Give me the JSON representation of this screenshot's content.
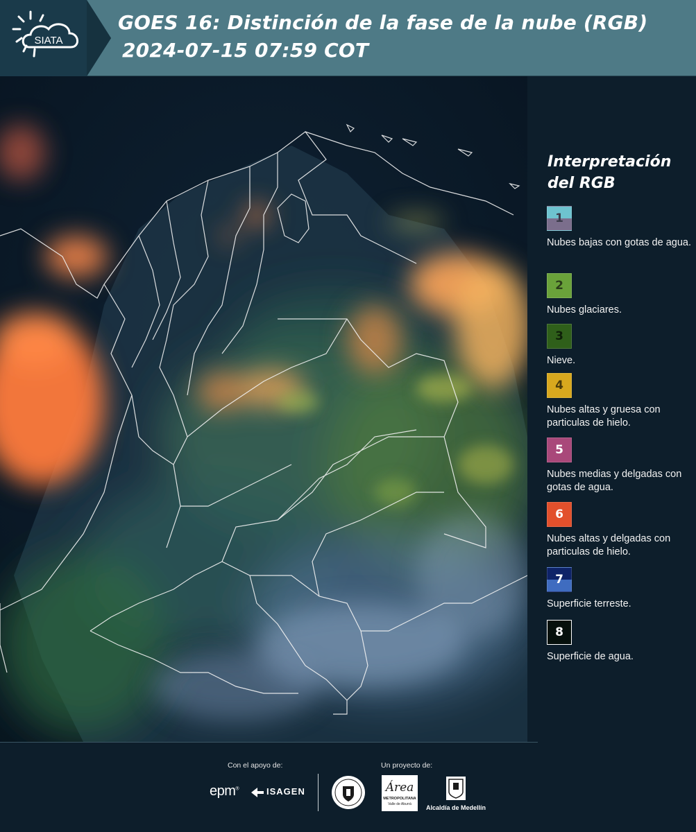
{
  "header": {
    "logo_text": "SIATA",
    "title_line1": "GOES 16: Distinción de la fase de la nube (RGB)",
    "title_line2": "2024-07-15 07:59 COT"
  },
  "map": {
    "ocean_color": "#0a1a2a",
    "boundary_color": "#f2f2f2",
    "cloud_colors": [
      "#ff7a3c",
      "#ffa85a",
      "#7fa53a",
      "#3a7d6a",
      "#b9cbe0"
    ]
  },
  "legend": {
    "title_line1": "Interpretación",
    "title_line2": "del RGB",
    "items": [
      {
        "number": "1",
        "label": "Nubes bajas con gotas de agua.",
        "color_top": "#6ec3cf",
        "color_bottom": "#7b6e8c"
      },
      {
        "number": "2",
        "label": "Nubes glaciares.",
        "color": "#6aa23a"
      },
      {
        "number": "3",
        "label": "Nieve.",
        "color": "#2f5f1a"
      },
      {
        "number": "4",
        "label": "Nubes altas y gruesa con particulas de hielo.",
        "color": "#d8a81e"
      },
      {
        "number": "5",
        "label": "Nubes medias y delgadas con gotas de agua.",
        "color": "#a9487a"
      },
      {
        "number": "6",
        "label": "Nubes altas y delgadas con particulas de hielo.",
        "color": "#e2502c"
      },
      {
        "number": "7",
        "label": "Superficie terreste.",
        "color_top": "#0e2368",
        "color_bottom": "#3f6cc0"
      },
      {
        "number": "8",
        "label": "Superficie de agua.",
        "color": "#06100c"
      }
    ]
  },
  "footer": {
    "support_label": "Con el apoyo de:",
    "project_label": "Un proyecto de:",
    "epm": "epm",
    "isagen": "ISAGEN",
    "area_name": "Área",
    "area_sub": "METROPOLITANA",
    "area_sub2": "Valle de Aburrá",
    "alcaldia": "Alcaldía de Medellín"
  }
}
